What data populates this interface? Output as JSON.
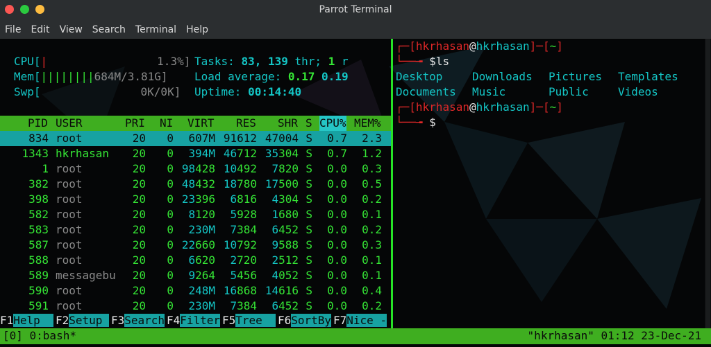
{
  "window": {
    "title": "Parrot Terminal",
    "buttons": [
      {
        "name": "close",
        "color": "#fc5753"
      },
      {
        "name": "minimize",
        "color": "#2bc93f"
      },
      {
        "name": "maximize",
        "color": "#fdbc40"
      }
    ]
  },
  "menu": [
    "File",
    "Edit",
    "View",
    "Search",
    "Terminal",
    "Help"
  ],
  "htop": {
    "cpu_label": "CPU[",
    "cpu_bar": "|",
    "cpu_value": "1.3%]",
    "mem_label": "Mem[",
    "mem_bar": "||||||||",
    "mem_value": "684M/3.81G]",
    "swp_label": "Swp[",
    "swp_value": "0K/0K]",
    "tasks_label": "Tasks:",
    "tasks_value": "83,",
    "thr_value": "139",
    "thr_label": "thr;",
    "running_value": "1",
    "running_label": "r",
    "load_label": "Load average:",
    "load1": "0.17",
    "load5": "0.19",
    "uptime_label": "Uptime:",
    "uptime_value": "00:14:40",
    "columns": [
      "PID",
      "USER",
      "PRI",
      "NI",
      "VIRT",
      "RES",
      "SHR",
      "S",
      "CPU%",
      "MEM%"
    ],
    "processes": [
      [
        "834",
        "root",
        "20",
        "0",
        "607M",
        "91612",
        "47004",
        "S",
        "0.7",
        "2.3"
      ],
      [
        "1343",
        "hkrhasan",
        "20",
        "0",
        "394M",
        "46712",
        "35304",
        "S",
        "0.7",
        "1.2"
      ],
      [
        "1",
        "root",
        "20",
        "0",
        "98428",
        "10492",
        "7820",
        "S",
        "0.0",
        "0.3"
      ],
      [
        "382",
        "root",
        "20",
        "0",
        "48432",
        "18780",
        "17500",
        "S",
        "0.0",
        "0.5"
      ],
      [
        "398",
        "root",
        "20",
        "0",
        "23396",
        "6816",
        "4304",
        "S",
        "0.0",
        "0.2"
      ],
      [
        "582",
        "root",
        "20",
        "0",
        "8120",
        "5928",
        "1680",
        "S",
        "0.0",
        "0.1"
      ],
      [
        "583",
        "root",
        "20",
        "0",
        "230M",
        "7384",
        "6452",
        "S",
        "0.0",
        "0.2"
      ],
      [
        "587",
        "root",
        "20",
        "0",
        "22660",
        "10792",
        "9588",
        "S",
        "0.0",
        "0.3"
      ],
      [
        "588",
        "root",
        "20",
        "0",
        "6620",
        "2720",
        "2512",
        "S",
        "0.0",
        "0.1"
      ],
      [
        "589",
        "messagebu",
        "20",
        "0",
        "9264",
        "5456",
        "4052",
        "S",
        "0.0",
        "0.1"
      ],
      [
        "590",
        "root",
        "20",
        "0",
        "248M",
        "16868",
        "14616",
        "S",
        "0.0",
        "0.4"
      ],
      [
        "591",
        "root",
        "20",
        "0",
        "230M",
        "7384",
        "6452",
        "S",
        "0.0",
        "0.2"
      ]
    ],
    "fkeys": [
      {
        "key": "F1",
        "label": "Help  "
      },
      {
        "key": "F2",
        "label": "Setup "
      },
      {
        "key": "F3",
        "label": "Search"
      },
      {
        "key": "F4",
        "label": "Filter"
      },
      {
        "key": "F5",
        "label": "Tree  "
      },
      {
        "key": "F6",
        "label": "SortBy"
      },
      {
        "key": "F7",
        "label": "Nice -"
      }
    ]
  },
  "shell": {
    "user": "hkrhasan",
    "at": "@",
    "host": "hkrhasan",
    "dir": "~",
    "cmd1": "ls",
    "ls_output": [
      [
        "Desktop",
        "Downloads",
        "Pictures",
        "Templates"
      ],
      [
        "Documents",
        "Music",
        "Public",
        "Videos"
      ]
    ],
    "prompt_symbol": "$"
  },
  "tmux": {
    "left": "[0] 0:bash*",
    "right": "\"hkrhasan\" 01:12 23-Dec-21"
  }
}
